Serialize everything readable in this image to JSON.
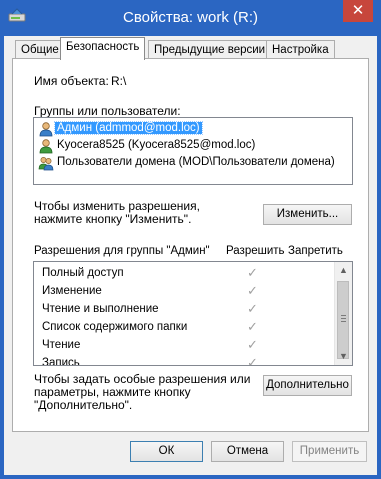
{
  "window": {
    "title": "Свойства: work (R:)",
    "close_glyph": "✕"
  },
  "tabs": [
    {
      "label": "Общие"
    },
    {
      "label": "Безопасность"
    },
    {
      "label": "Предыдущие версии"
    },
    {
      "label": "Настройка"
    }
  ],
  "object": {
    "label": "Имя объекта:",
    "value": "R:\\"
  },
  "groups": {
    "label": "Группы или пользователи:",
    "items": [
      {
        "name": "Админ (admmod@mod.loc)",
        "selected": true,
        "icon": "user-icon"
      },
      {
        "name": "Kyocera8525 (Kyocera8525@mod.loc)",
        "selected": false,
        "icon": "user-icon"
      },
      {
        "name": "Пользователи домена (MOD\\Пользователи домена)",
        "selected": false,
        "icon": "group-icon"
      }
    ]
  },
  "change": {
    "hint_line1": "Чтобы изменить разрешения,",
    "hint_line2": "нажмите кнопку \"Изменить\".",
    "button": "Изменить..."
  },
  "permissions": {
    "header": "Разрешения для группы \"Админ\"",
    "allow_header": "Разрешить",
    "deny_header": "Запретить",
    "items": [
      {
        "name": "Полный доступ",
        "allow": true
      },
      {
        "name": "Изменение",
        "allow": true
      },
      {
        "name": "Чтение и выполнение",
        "allow": true
      },
      {
        "name": "Список содержимого папки",
        "allow": true
      },
      {
        "name": "Чтение",
        "allow": true
      },
      {
        "name": "Запись",
        "allow": true
      }
    ],
    "check_glyph": "✓"
  },
  "advanced": {
    "hint_line1": "Чтобы задать особые разрешения или",
    "hint_line2": "параметры, нажмите кнопку",
    "hint_line3": "\"Дополнительно\".",
    "button": "Дополнительно"
  },
  "footer": {
    "ok": "ОК",
    "cancel": "Отмена",
    "apply": "Применить"
  },
  "colors": {
    "titlebar": "#2b66c2",
    "selection": "#3399ff",
    "close": "#c7463c"
  }
}
